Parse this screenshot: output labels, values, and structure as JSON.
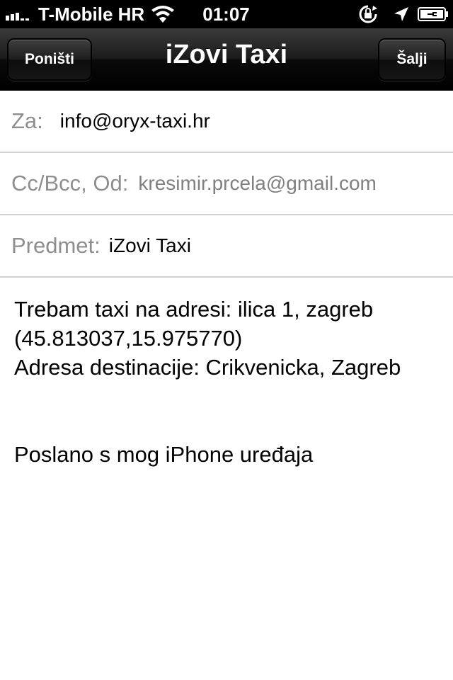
{
  "status_bar": {
    "carrier": "T-Mobile HR",
    "time": "01:07",
    "icons": [
      "signal-icon",
      "wifi-icon",
      "rotation-lock-icon",
      "location-icon",
      "battery-icon"
    ]
  },
  "nav": {
    "title": "iZovi Taxi",
    "cancel_label": "Poništi",
    "send_label": "Šalji"
  },
  "fields": {
    "to": {
      "label": "Za:",
      "value": "info@oryx-taxi.hr"
    },
    "cc": {
      "label": "Cc/Bcc, Od:",
      "value": "kresimir.prcela@gmail.com"
    },
    "subject": {
      "label": "Predmet:",
      "value": "iZovi Taxi"
    }
  },
  "body": {
    "lines": [
      "Trebam taxi na adresi: ilica 1, zagreb",
      "(45.813037,15.975770)",
      "Adresa destinacije: Crikvenicka, Zagreb"
    ],
    "signature": "Poslano s mog iPhone uređaja"
  },
  "colors": {
    "nav_background": "#000000",
    "field_label": "#8e8e8e",
    "separator": "#d0d0d0"
  }
}
